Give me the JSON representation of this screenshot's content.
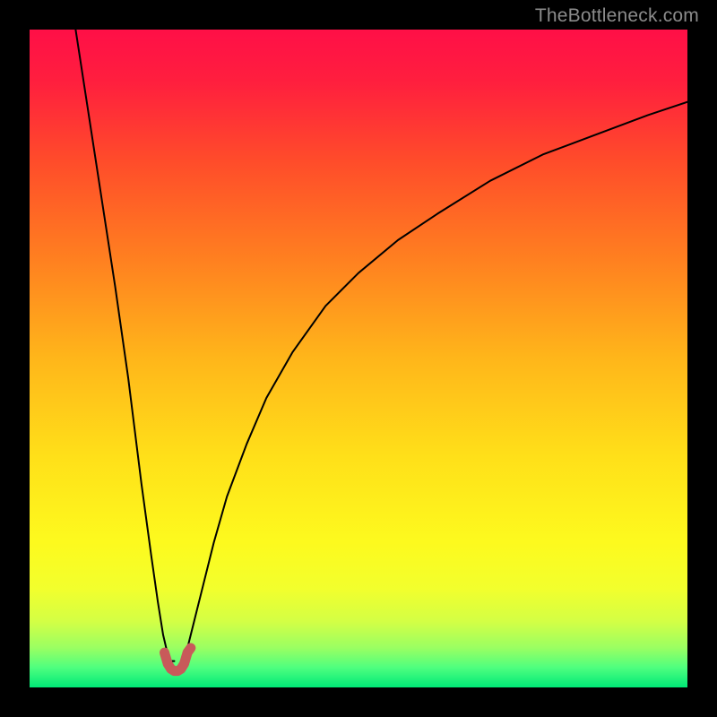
{
  "watermark": "TheBottleneck.com",
  "chart_data": {
    "type": "line",
    "title": "",
    "xlabel": "",
    "ylabel": "",
    "xlim": [
      0,
      100
    ],
    "ylim": [
      0,
      100
    ],
    "grid": false,
    "legend": false,
    "gradient_stops": [
      {
        "pos": 0.0,
        "color": "#ff0f47"
      },
      {
        "pos": 0.08,
        "color": "#ff1f3e"
      },
      {
        "pos": 0.2,
        "color": "#ff4c2a"
      },
      {
        "pos": 0.35,
        "color": "#ff8020"
      },
      {
        "pos": 0.5,
        "color": "#ffb61a"
      },
      {
        "pos": 0.65,
        "color": "#ffe019"
      },
      {
        "pos": 0.78,
        "color": "#fdfa1e"
      },
      {
        "pos": 0.85,
        "color": "#f2ff2d"
      },
      {
        "pos": 0.9,
        "color": "#d3ff45"
      },
      {
        "pos": 0.94,
        "color": "#9aff62"
      },
      {
        "pos": 0.97,
        "color": "#4eff7f"
      },
      {
        "pos": 1.0,
        "color": "#00e977"
      }
    ],
    "series": [
      {
        "name": "left-branch",
        "color": "#000000",
        "width": 2,
        "x": [
          7,
          9,
          11,
          13,
          15,
          17,
          18.5,
          19.5,
          20.3,
          21,
          21.5,
          22
        ],
        "y": [
          100,
          87,
          74,
          61,
          47,
          31,
          20,
          13,
          8,
          5,
          4,
          4
        ]
      },
      {
        "name": "right-branch",
        "color": "#000000",
        "width": 2,
        "x": [
          23,
          23.5,
          24,
          25,
          26.5,
          28,
          30,
          33,
          36,
          40,
          45,
          50,
          56,
          62,
          70,
          78,
          86,
          94,
          100
        ],
        "y": [
          4,
          4.5,
          6,
          10,
          16,
          22,
          29,
          37,
          44,
          51,
          58,
          63,
          68,
          72,
          77,
          81,
          84,
          87,
          89
        ]
      },
      {
        "name": "minimum-marker",
        "color": "#c85a5a",
        "width": 11,
        "x": [
          20.5,
          21.0,
          21.5,
          22.0,
          22.5,
          23.0,
          23.5,
          24.0,
          24.5
        ],
        "y": [
          5.3,
          3.6,
          2.8,
          2.5,
          2.5,
          2.8,
          3.6,
          5.3,
          6.0
        ]
      }
    ]
  }
}
